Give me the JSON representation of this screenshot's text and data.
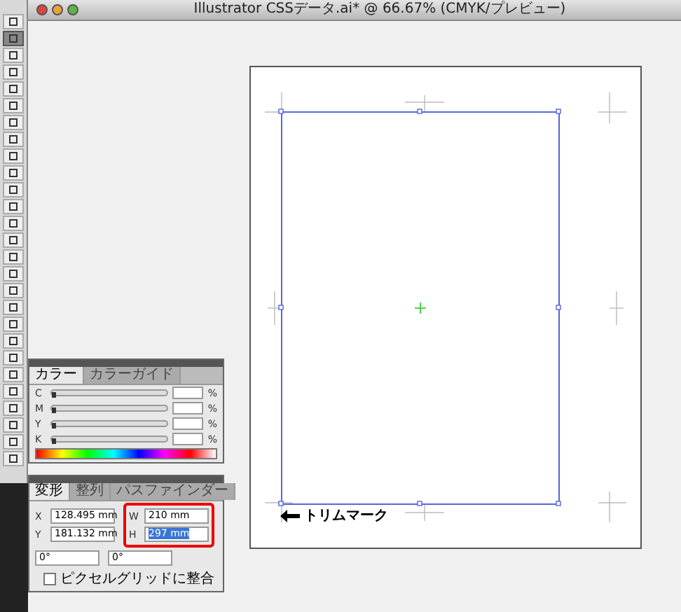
{
  "window": {
    "title": "Illustrator CSSデータ.ai* @ 66.67% (CMYK/プレビュー)"
  },
  "tools": [
    {
      "selected": false
    },
    {
      "selected": true
    },
    {
      "selected": false
    },
    {
      "selected": false
    },
    {
      "selected": false
    },
    {
      "selected": false
    },
    {
      "selected": false
    },
    {
      "selected": false
    },
    {
      "selected": false
    },
    {
      "selected": false
    },
    {
      "selected": false
    },
    {
      "selected": false
    },
    {
      "selected": false
    },
    {
      "selected": false
    },
    {
      "selected": false
    },
    {
      "selected": false
    },
    {
      "selected": false
    },
    {
      "selected": false
    },
    {
      "selected": false
    },
    {
      "selected": false
    },
    {
      "selected": false
    },
    {
      "selected": false
    },
    {
      "selected": false
    },
    {
      "selected": false
    },
    {
      "selected": false
    },
    {
      "selected": false
    },
    {
      "selected": false
    }
  ],
  "color_panel": {
    "tabs": [
      {
        "label": "カラー",
        "selected": true
      },
      {
        "label": "カラーガイド",
        "selected": false
      }
    ],
    "channels": [
      {
        "label": "C",
        "level": 0,
        "unit": "%"
      },
      {
        "label": "M",
        "level": 0,
        "unit": "%"
      },
      {
        "label": "Y",
        "level": 0,
        "unit": "%"
      },
      {
        "label": "K",
        "level": 0,
        "unit": "%"
      }
    ]
  },
  "transform_panel": {
    "tabs": [
      {
        "label": "変形",
        "selected": true
      },
      {
        "label": "整列",
        "selected": false
      },
      {
        "label": "パスファインダー",
        "selected": false
      }
    ],
    "position": [
      {
        "label": "X",
        "value": "128.495 mm"
      },
      {
        "label": "Y",
        "value": "181.132 mm"
      }
    ],
    "size": {
      "outlined": true,
      "fields": [
        {
          "label": "W",
          "value": "210 mm",
          "selected": false
        },
        {
          "label": "H",
          "value": "297 mm",
          "selected": true
        }
      ]
    },
    "angles": [
      {
        "value": "0°"
      },
      {
        "value": "0°"
      }
    ],
    "checkbox": {
      "label": "ピクセルグリッドに整合",
      "checked": false
    }
  },
  "annotation": {
    "label": "トリムマーク"
  }
}
